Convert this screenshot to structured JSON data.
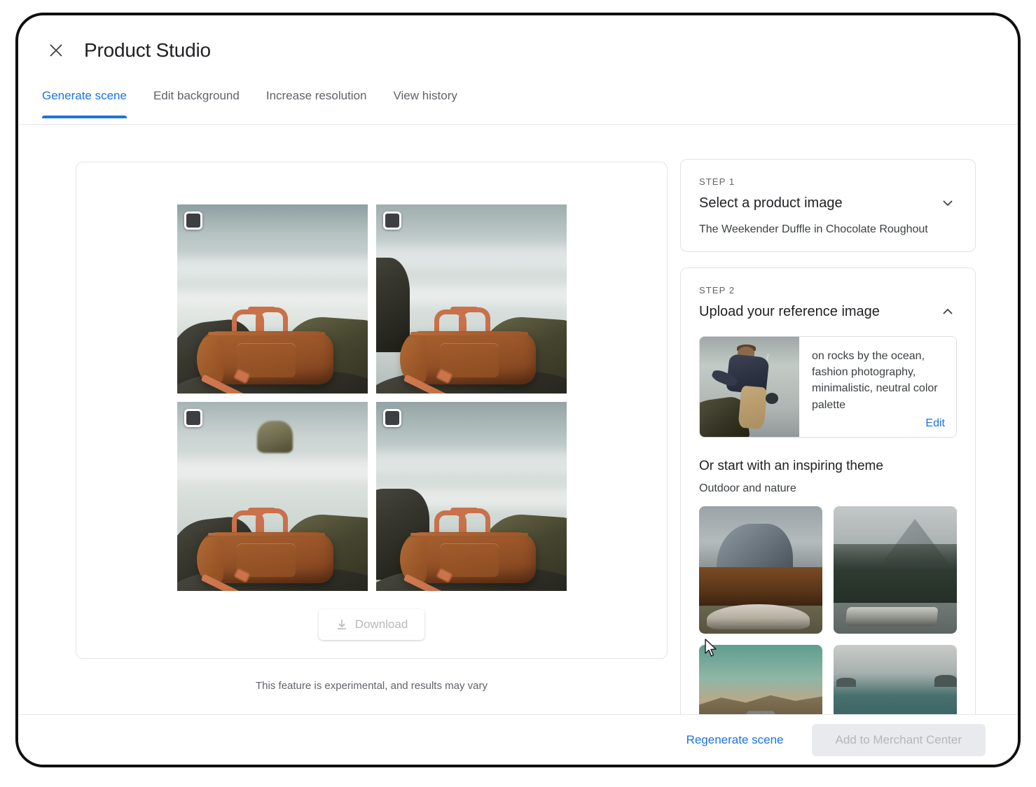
{
  "window": {
    "title": "Product Studio",
    "close_icon": "close-icon"
  },
  "tabs": [
    {
      "label": "Generate scene",
      "active": true
    },
    {
      "label": "Edit background",
      "active": false
    },
    {
      "label": "Increase resolution",
      "active": false
    },
    {
      "label": "View history",
      "active": false
    }
  ],
  "canvas": {
    "results": [
      {
        "alt": "duffle bag on rocks by the ocean, wide water backdrop",
        "selected": true
      },
      {
        "alt": "duffle bag on rocks with cliff at left",
        "selected": true
      },
      {
        "alt": "duffle bag on rocks with sea stack in background",
        "selected": true
      },
      {
        "alt": "duffle bag on dark rocks, calm sea",
        "selected": true
      }
    ],
    "download_label": "Download",
    "download_icon": "download-icon",
    "footnote": "This feature is experimental, and results may vary"
  },
  "sidebar": {
    "step1": {
      "step_label": "STEP 1",
      "title": "Select a product image",
      "selected_product": "The Weekender Duffle in Chocolate Roughout",
      "chevron_icon": "chevron-down-icon"
    },
    "step2": {
      "step_label": "STEP 2",
      "title": "Upload your reference image",
      "chevron_icon": "chevron-up-icon",
      "prompt_text": "on rocks by the ocean, fashion photography, minimalistic, neutral color palette",
      "edit_label": "Edit",
      "reference_thumb_alt": "man fishing on rocks by the ocean",
      "theme_heading": "Or start with an inspiring theme",
      "theme_category": "Outdoor and nature",
      "themes": [
        {
          "alt": "granite cliff with autumn trees and stone podium"
        },
        {
          "alt": "foggy pine forest with slate slabs"
        },
        {
          "alt": "desert highway through hills"
        },
        {
          "alt": "ocean view from a wooden dock"
        }
      ]
    }
  },
  "actions": {
    "regenerate_label": "Regenerate scene",
    "add_label": "Add to Merchant Center"
  },
  "colors": {
    "accent": "#1a73e8",
    "text_primary": "#202124",
    "text_secondary": "#5f6368",
    "border": "#e1e3e6",
    "disabled_bg": "#e8eaed"
  }
}
